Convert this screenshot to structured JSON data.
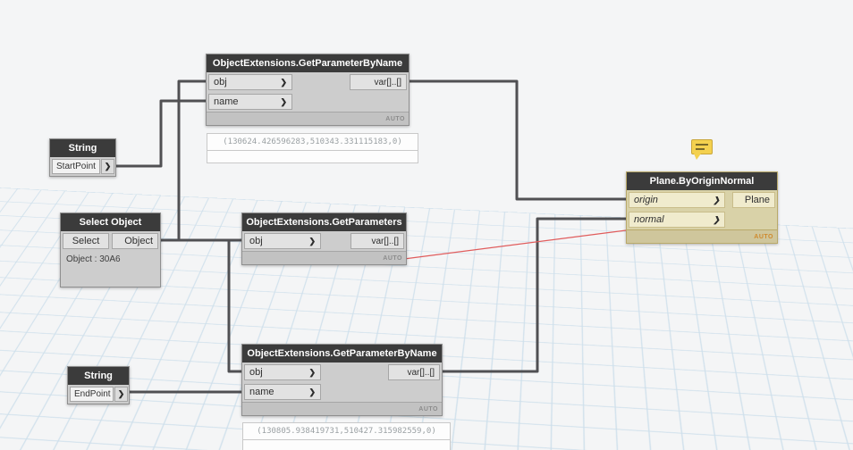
{
  "ui": {
    "chevron": "❯"
  },
  "colors": {
    "wire": "#505053",
    "error_wire": "#e05c5c",
    "note_yellow": "#f4d14f",
    "grid_line": "#c3d9e8",
    "node_header": "#3b3b3b",
    "plane_port_tint": "#f0ebcd"
  },
  "nodes": {
    "get_param_top": {
      "title": "ObjectExtensions.GetParameterByName",
      "inputs": [
        "obj",
        "name"
      ],
      "output": "var[]..[]",
      "lacing": "AUTO",
      "preview": "(130624.426596283,510343.331115183,0)"
    },
    "string_start": {
      "title": "String",
      "value": "StartPoint"
    },
    "select_object": {
      "title": "Select Object",
      "button": "Select",
      "output": "Object",
      "value": "Object : 30A6"
    },
    "get_parameters": {
      "title": "ObjectExtensions.GetParameters",
      "inputs": [
        "obj"
      ],
      "output": "var[]..[]",
      "lacing": "AUTO"
    },
    "plane_by_origin_normal": {
      "title": "Plane.ByOriginNormal",
      "inputs": [
        "origin",
        "normal"
      ],
      "output": "Plane",
      "lacing": "AUTO"
    },
    "get_param_bottom": {
      "title": "ObjectExtensions.GetParameterByName",
      "inputs": [
        "obj",
        "name"
      ],
      "output": "var[]..[]",
      "lacing": "AUTO",
      "preview": "(130805.938419731,510427.315982559,0)"
    },
    "string_end": {
      "title": "String",
      "value": "EndPoint"
    }
  }
}
